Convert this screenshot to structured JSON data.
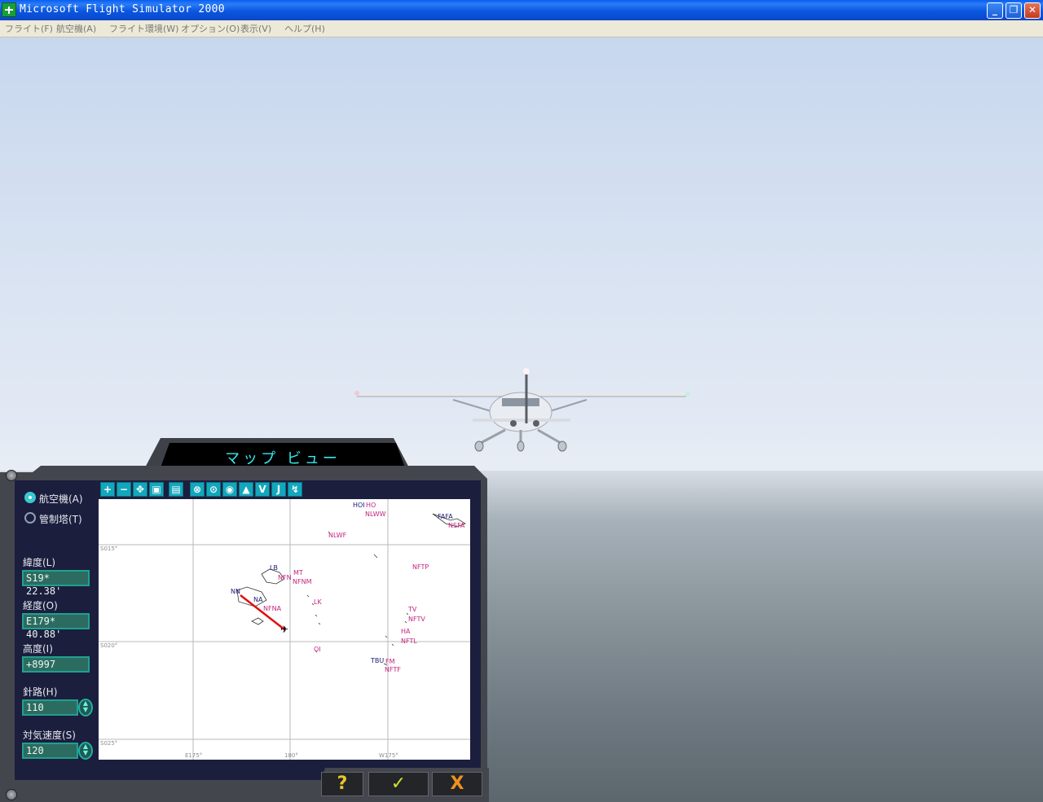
{
  "window": {
    "title": "Microsoft Flight Simulator 2000",
    "minimize": "_",
    "maximize": "❐",
    "close": "✕"
  },
  "menu": [
    "フライト(F)",
    "航空機(A)",
    "フライト環境(W)",
    "オプション(O)",
    "表示(V)",
    "ヘルプ(H)"
  ],
  "map_view": {
    "title": "マップ ビュー",
    "radio_aircraft": "航空機(A)",
    "radio_tower": "管制塔(T)",
    "latitude_label": "緯度(L)",
    "latitude_value": "S19* 22.38'",
    "longitude_label": "経度(O)",
    "longitude_value": "E179* 40.88'",
    "altitude_label": "高度(I)",
    "altitude_value": "+8997",
    "heading_label": "針路(H)",
    "heading_value": "110",
    "airspeed_label": "対気速度(S)",
    "airspeed_value": "120",
    "toolbar": [
      "zoom-in-icon",
      "zoom-out-icon",
      "center-icon",
      "layers-icon",
      "map-icon",
      "vor-icon",
      "ndb-icon",
      "airport-icon",
      "triangle-icon",
      "V",
      "J",
      "route-icon"
    ],
    "grid_labels": {
      "lat_s015": "S015°",
      "lat_s020": "S020°",
      "lat_s025": "S025°",
      "lon_e175": "E175°",
      "lon_180": "180°",
      "lon_w175": "W175°"
    },
    "map_labels": [
      {
        "text": "HOI",
        "c": "b"
      },
      {
        "text": "HO",
        "c": "m"
      },
      {
        "text": "NLWW",
        "c": "m"
      },
      {
        "text": "FAFA",
        "c": "b"
      },
      {
        "text": "NSFA",
        "c": "m"
      },
      {
        "text": "NLWF",
        "c": "m"
      },
      {
        "text": "NFTP",
        "c": "m"
      },
      {
        "text": "LB",
        "c": "b"
      },
      {
        "text": "MT",
        "c": "m"
      },
      {
        "text": "NFN",
        "c": "m"
      },
      {
        "text": "NFNM",
        "c": "m"
      },
      {
        "text": "NN",
        "c": "b"
      },
      {
        "text": "NA",
        "c": "b"
      },
      {
        "text": "NFNA",
        "c": "m"
      },
      {
        "text": "LK",
        "c": "m"
      },
      {
        "text": "TV",
        "c": "m"
      },
      {
        "text": "NFTV",
        "c": "m"
      },
      {
        "text": "HA",
        "c": "m"
      },
      {
        "text": "NFTL",
        "c": "m"
      },
      {
        "text": "OI",
        "c": "m"
      },
      {
        "text": "TBU",
        "c": "b"
      },
      {
        "text": "FM",
        "c": "m"
      },
      {
        "text": "NFTF",
        "c": "m"
      }
    ]
  },
  "buttons": {
    "help": "?",
    "ok": "✓",
    "cancel": "X"
  },
  "colors": {
    "accent": "#37e8ee",
    "panel": "#43464d",
    "map_magenta": "#c4247e",
    "route": "#e01010"
  }
}
